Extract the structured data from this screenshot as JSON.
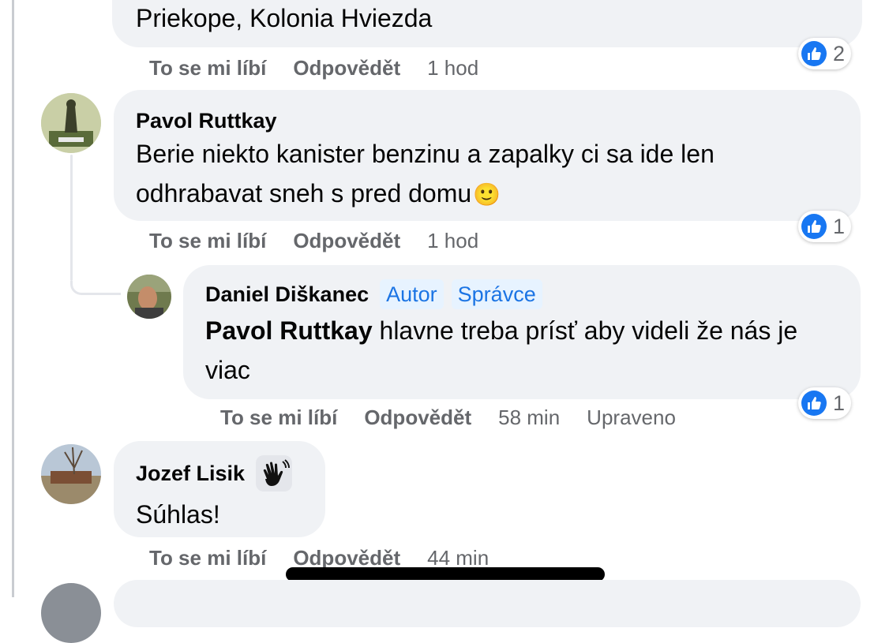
{
  "comments": [
    {
      "text": "Priekope, Kolonia Hviezda",
      "actions": {
        "like": "To se mi líbí",
        "reply": "Odpovědět",
        "time": "1 hod"
      },
      "reactions": {
        "icon": "like-icon",
        "count": "2"
      }
    },
    {
      "author": "Pavol Ruttkay",
      "text": "Berie niekto kanister benzinu a zapalky ci sa ide len odhrabavat sneh s pred domu",
      "emoji": "🙂",
      "actions": {
        "like": "To se mi líbí",
        "reply": "Odpovědět",
        "time": "1 hod"
      },
      "reactions": {
        "icon": "like-icon",
        "count": "1"
      }
    },
    {
      "author": "Daniel Diškanec",
      "badges": [
        "Autor",
        "Správce"
      ],
      "mention": "Pavol Ruttkay",
      "text": "hlavne treba prísť aby videli že nás je viac",
      "actions": {
        "like": "To se mi líbí",
        "reply": "Odpovědět",
        "time": "58 min",
        "edited": "Upraveno"
      },
      "reactions": {
        "icon": "like-icon",
        "count": "1"
      }
    },
    {
      "author": "Jozef Lisik",
      "author_badge_icon": "waving-hand-icon",
      "text": "Súhlas!",
      "actions": {
        "like": "To se mi líbí",
        "reply": "Odpovědět",
        "time": "44 min"
      }
    }
  ],
  "colors": {
    "bubble": "#f0f2f5",
    "like_blue": "#1877f2",
    "badge_bg": "#e7f3ff",
    "badge_text": "#1b74e4",
    "meta_gray": "#65676b"
  }
}
